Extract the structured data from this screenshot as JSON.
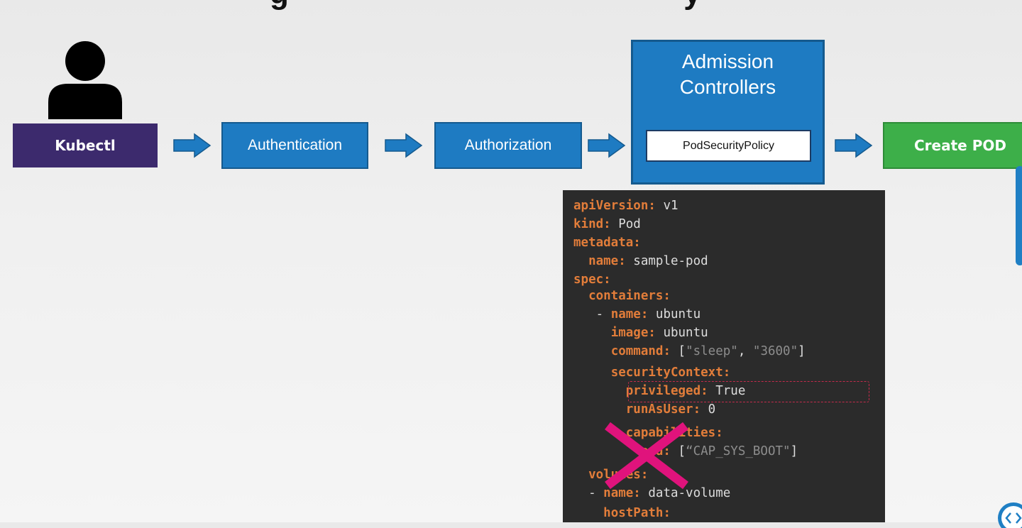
{
  "nodes": {
    "kubectl": "Kubectl",
    "authentication": "Authentication",
    "authorization": "Authorization",
    "admission_title_line1": "Admission",
    "admission_title_line2": "Controllers",
    "admission_plugin": "PodSecurityPolicy",
    "create_pod": "Create POD"
  },
  "icons": [
    "user-icon",
    "arrow-right-icon",
    "cross-icon",
    "code-view-icon"
  ],
  "colors": {
    "kubectl_bg": "#3c2a6d",
    "stage_blue": "#1e7bc2",
    "create_green": "#3daf49",
    "code_bg": "#2b2b2b",
    "code_key": "#e27d3a",
    "denied_cross": "#e0137c"
  },
  "code": {
    "lines": [
      {
        "indent": "",
        "dash": "",
        "key": "apiVersion:",
        "value": " v1"
      },
      {
        "indent": "",
        "dash": "",
        "key": "kind:",
        "value": " Pod"
      },
      {
        "indent": "",
        "dash": "",
        "key": "metadata:",
        "value": ""
      },
      {
        "indent": "  ",
        "dash": "",
        "key": "name:",
        "value": " sample-pod"
      },
      {
        "indent": "",
        "dash": "",
        "key": "spec:",
        "value": ""
      },
      {
        "indent": "  ",
        "dash": "",
        "key": "containers:",
        "value": ""
      },
      {
        "indent": "   ",
        "dash": "- ",
        "key": "name:",
        "value": " ubuntu"
      },
      {
        "indent": "     ",
        "dash": "",
        "key": "image:",
        "value": " ubuntu"
      },
      {
        "indent": "     ",
        "dash": "",
        "key": "command:",
        "value": " [",
        "s1": "\"sleep\"",
        "mid": ", ",
        "s2": "\"3600\"",
        "end": "]"
      },
      {
        "indent": "     ",
        "dash": "",
        "key": "securityContext:",
        "value": ""
      },
      {
        "indent": "       ",
        "dash": "",
        "key": "privileged:",
        "value": " True"
      },
      {
        "indent": "       ",
        "dash": "",
        "key": "runAsUser:",
        "value": " 0"
      },
      {
        "indent": "       ",
        "dash": "",
        "key": "capabilities:",
        "value": ""
      },
      {
        "indent": "         ",
        "dash": "",
        "key": "add:",
        "value": " [",
        "s1": "“CAP_SYS_BOOT\"",
        "end": "]"
      },
      {
        "indent": "  ",
        "dash": "",
        "key": "volumes:",
        "value": ""
      },
      {
        "indent": "  ",
        "dash": "- ",
        "key": "name:",
        "value": " data-volume"
      },
      {
        "indent": "    ",
        "dash": "",
        "key": "hostPath:",
        "value": ""
      }
    ]
  }
}
